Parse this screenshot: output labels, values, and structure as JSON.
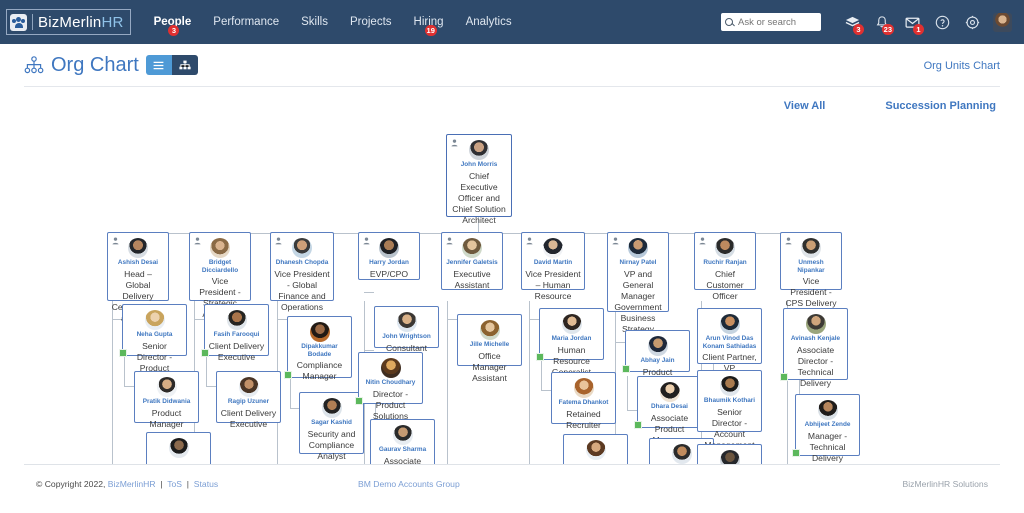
{
  "topbar": {
    "logo": {
      "name": "BizMerlin",
      "suffix": "HR",
      "icon": "people-icon"
    },
    "nav": [
      {
        "label": "People",
        "badge": "3",
        "active": true
      },
      {
        "label": "Performance",
        "badge": "",
        "active": false
      },
      {
        "label": "Skills",
        "badge": "",
        "active": false
      },
      {
        "label": "Projects",
        "badge": "",
        "active": false
      },
      {
        "label": "Hiring",
        "badge": "19",
        "active": false
      },
      {
        "label": "Analytics",
        "badge": "",
        "active": false
      }
    ],
    "search": {
      "placeholder": "Ask or search",
      "value": "",
      "icon": "search-icon"
    },
    "icons": [
      {
        "name": "layers-icon",
        "badge": "3"
      },
      {
        "name": "bell-icon",
        "badge": "23"
      },
      {
        "name": "envelope-icon",
        "badge": "1"
      },
      {
        "name": "help-icon",
        "badge": ""
      },
      {
        "name": "gear-icon",
        "badge": ""
      }
    ],
    "avatar": "user-avatar"
  },
  "page": {
    "title": "Org Chart",
    "title_icon": "org-chart-icon",
    "view_toggle": {
      "list": "list-view-icon",
      "tree": "tree-view-icon",
      "active": "list"
    },
    "org_units_link": "Org Units Chart",
    "view_all_link": "View All",
    "succession_link": "Succession Planning"
  },
  "chart_data": {
    "type": "org-tree",
    "root": {
      "name": "John Morris",
      "title": "Chief Executive Officer and Chief Solution Architect"
    },
    "nodes": [
      {
        "name": "Ashish Desai",
        "title": "Head – Global Delivery Center (India) and EVP",
        "level": 2
      },
      {
        "name": "Bridget Dicciardello",
        "title": "Vice President - Strategic Accounts",
        "level": 2
      },
      {
        "name": "Dhanesh Chopda",
        "title": "Vice President - Global Finance and Operations",
        "level": 2
      },
      {
        "name": "Harry Jordan",
        "title": "EVP/CPO",
        "level": 2
      },
      {
        "name": "Jennifer Galetsis",
        "title": "Executive Assistant",
        "level": 2
      },
      {
        "name": "David Martin",
        "title": "Vice President – Human Resource",
        "level": 2
      },
      {
        "name": "Nirnay Patel",
        "title": "VP and General Manager Government Business Strategy",
        "level": 2
      },
      {
        "name": "Ruchir Ranjan",
        "title": "Chief Customer Officer",
        "level": 2
      },
      {
        "name": "Unmesh Nipankar",
        "title": "Vice President - CPS Delivery",
        "level": 2
      },
      {
        "name": "Neha Gupta",
        "title": "Senior Director - Product Solutions",
        "level": 3
      },
      {
        "name": "Pratik Didwania",
        "title": "Product Manager",
        "level": 4
      },
      {
        "name": "Fasih Farooqui",
        "title": "Client Delivery Executive",
        "level": 3
      },
      {
        "name": "Ragip Uzuner",
        "title": "Client Delivery Executive",
        "level": 4
      },
      {
        "name": "Dipakkumar Bodade",
        "title": "Compliance Manager",
        "level": 3
      },
      {
        "name": "Sagar Kashid",
        "title": "Security and Compliance Analyst",
        "level": 4
      },
      {
        "name": "John Wrightson",
        "title": "Consultant",
        "level": 3
      },
      {
        "name": "Nitin Choudhary",
        "title": "Director - Product Solutions",
        "level": 3
      },
      {
        "name": "Gaurav Sharma",
        "title": "Associate",
        "level": 4
      },
      {
        "name": "Jille Michelle",
        "title": "Office Manager Assistant",
        "level": 3
      },
      {
        "name": "Maria Jordan",
        "title": "Human Resource Generalist",
        "level": 3
      },
      {
        "name": "Fatema Dhankot",
        "title": "Retained Recruiter",
        "level": 4
      },
      {
        "name": "Abhay Jain",
        "title": "Product Manager",
        "level": 3
      },
      {
        "name": "Dhara Desai",
        "title": "Associate Product Manager",
        "level": 4
      },
      {
        "name": "Arun Vinod Das Konam Sathiadas",
        "title": "Client Partner, VP",
        "level": 3
      },
      {
        "name": "Bhaumik Kothari",
        "title": "Senior Director - Account Management",
        "level": 4
      },
      {
        "name": "Avinash Kenjale",
        "title": "Associate Director - Technical Delivery",
        "level": 3
      },
      {
        "name": "Abhijeet Zende",
        "title": "Manager - Technical Delivery",
        "level": 4
      }
    ]
  },
  "footer": {
    "copyright": "© Copyright 2022,",
    "brand": "BizMerlinHR",
    "tos": "ToS",
    "status": "Status",
    "center": "BM Demo Accounts Group",
    "right": "BizMerlinHR Solutions"
  }
}
